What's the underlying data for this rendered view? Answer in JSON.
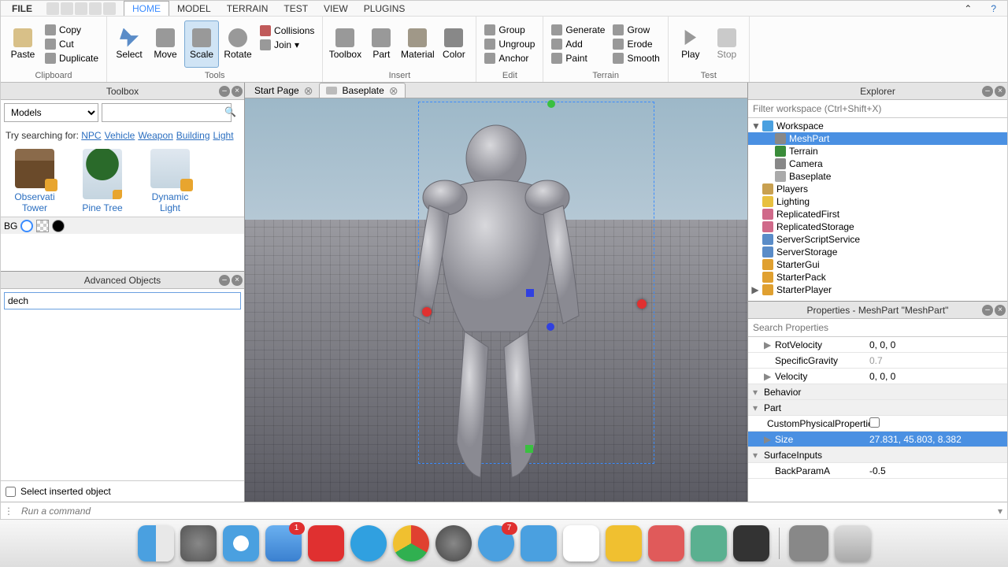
{
  "menu": {
    "file": "FILE",
    "items": [
      "HOME",
      "MODEL",
      "TERRAIN",
      "TEST",
      "VIEW",
      "PLUGINS"
    ],
    "active": 0
  },
  "ribbon": {
    "clipboard": {
      "label": "Clipboard",
      "paste": "Paste",
      "copy": "Copy",
      "cut": "Cut",
      "duplicate": "Duplicate"
    },
    "tools": {
      "label": "Tools",
      "select": "Select",
      "move": "Move",
      "scale": "Scale",
      "rotate": "Rotate",
      "collisions": "Collisions",
      "join": "Join"
    },
    "insert": {
      "label": "Insert",
      "toolbox": "Toolbox",
      "part": "Part",
      "material": "Material",
      "color": "Color"
    },
    "edit": {
      "label": "Edit",
      "group": "Group",
      "ungroup": "Ungroup",
      "anchor": "Anchor"
    },
    "terrain": {
      "label": "Terrain",
      "generate": "Generate",
      "add": "Add",
      "paint": "Paint",
      "grow": "Grow",
      "erode": "Erode",
      "smooth": "Smooth"
    },
    "test": {
      "label": "Test",
      "play": "Play",
      "stop": "Stop"
    }
  },
  "doctabs": {
    "start": "Start Page",
    "baseplate": "Baseplate"
  },
  "toolbox": {
    "title": "Toolbox",
    "dropdown": "Models",
    "hint_prefix": "Try searching for: ",
    "hints": [
      "NPC",
      "Vehicle",
      "Weapon",
      "Building",
      "Light"
    ],
    "items": [
      {
        "label": "Observati Tower"
      },
      {
        "label": "Pine Tree"
      },
      {
        "label": "Dynamic Light"
      }
    ],
    "bg": "BG"
  },
  "advobj": {
    "title": "Advanced Objects",
    "search": "dech",
    "checkbox": "Select inserted object"
  },
  "explorer": {
    "title": "Explorer",
    "filter_ph": "Filter workspace (Ctrl+Shift+X)",
    "tree": [
      {
        "l": "Workspace",
        "i": 0,
        "a": "▼",
        "ico": "#4aa0e0"
      },
      {
        "l": "MeshPart",
        "i": 1,
        "sel": true,
        "ico": "#888"
      },
      {
        "l": "Terrain",
        "i": 1,
        "ico": "#3a8c3a"
      },
      {
        "l": "Camera",
        "i": 1,
        "ico": "#888"
      },
      {
        "l": "Baseplate",
        "i": 1,
        "ico": "#aaa"
      },
      {
        "l": "Players",
        "i": 0,
        "ico": "#c8a050"
      },
      {
        "l": "Lighting",
        "i": 0,
        "ico": "#e8c040"
      },
      {
        "l": "ReplicatedFirst",
        "i": 0,
        "ico": "#d06a8a"
      },
      {
        "l": "ReplicatedStorage",
        "i": 0,
        "ico": "#d06a8a"
      },
      {
        "l": "ServerScriptService",
        "i": 0,
        "ico": "#5a8cc8"
      },
      {
        "l": "ServerStorage",
        "i": 0,
        "ico": "#5a8cc8"
      },
      {
        "l": "StarterGui",
        "i": 0,
        "ico": "#e0a030"
      },
      {
        "l": "StarterPack",
        "i": 0,
        "ico": "#e0a030"
      },
      {
        "l": "StarterPlayer",
        "i": 0,
        "a": "▶",
        "ico": "#e0a030"
      }
    ]
  },
  "properties": {
    "title": "Properties - MeshPart \"MeshPart\"",
    "search_ph": "Search Properties",
    "rows": [
      {
        "k": "RotVelocity",
        "v": "0, 0, 0",
        "arw": "▶"
      },
      {
        "k": "SpecificGravity",
        "v": "0.7",
        "dim": true
      },
      {
        "k": "Velocity",
        "v": "0, 0, 0",
        "arw": "▶"
      },
      {
        "k": "Behavior",
        "cat": true
      },
      {
        "k": "Part",
        "cat": true
      },
      {
        "k": "CustomPhysicalProperties",
        "v": "",
        "chk": true
      },
      {
        "k": "Size",
        "v": "27.831, 45.803, 8.382",
        "sel": true,
        "arw": "▶"
      },
      {
        "k": "SurfaceInputs",
        "cat": true
      },
      {
        "k": "BackParamA",
        "v": "-0.5"
      }
    ]
  },
  "cmd_ph": "Run a command"
}
